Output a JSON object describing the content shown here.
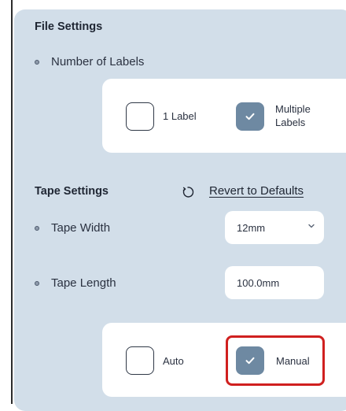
{
  "file_settings": {
    "title": "File Settings",
    "number_of_labels": {
      "label": "Number of Labels",
      "options": [
        {
          "label": "1 Label",
          "checked": false
        },
        {
          "label": "Multiple Labels",
          "checked": true
        }
      ]
    }
  },
  "tape_settings": {
    "title": "Tape Settings",
    "revert_label": "Revert to Defaults",
    "tape_width": {
      "label": "Tape Width",
      "value": "12mm"
    },
    "tape_length": {
      "label": "Tape Length",
      "value": "100.0mm",
      "options": [
        {
          "label": "Auto",
          "checked": false
        },
        {
          "label": "Manual",
          "checked": true
        }
      ]
    }
  },
  "colors": {
    "panel": "#d2dee9",
    "checked": "#6e89a2",
    "highlight": "#d0201f"
  }
}
